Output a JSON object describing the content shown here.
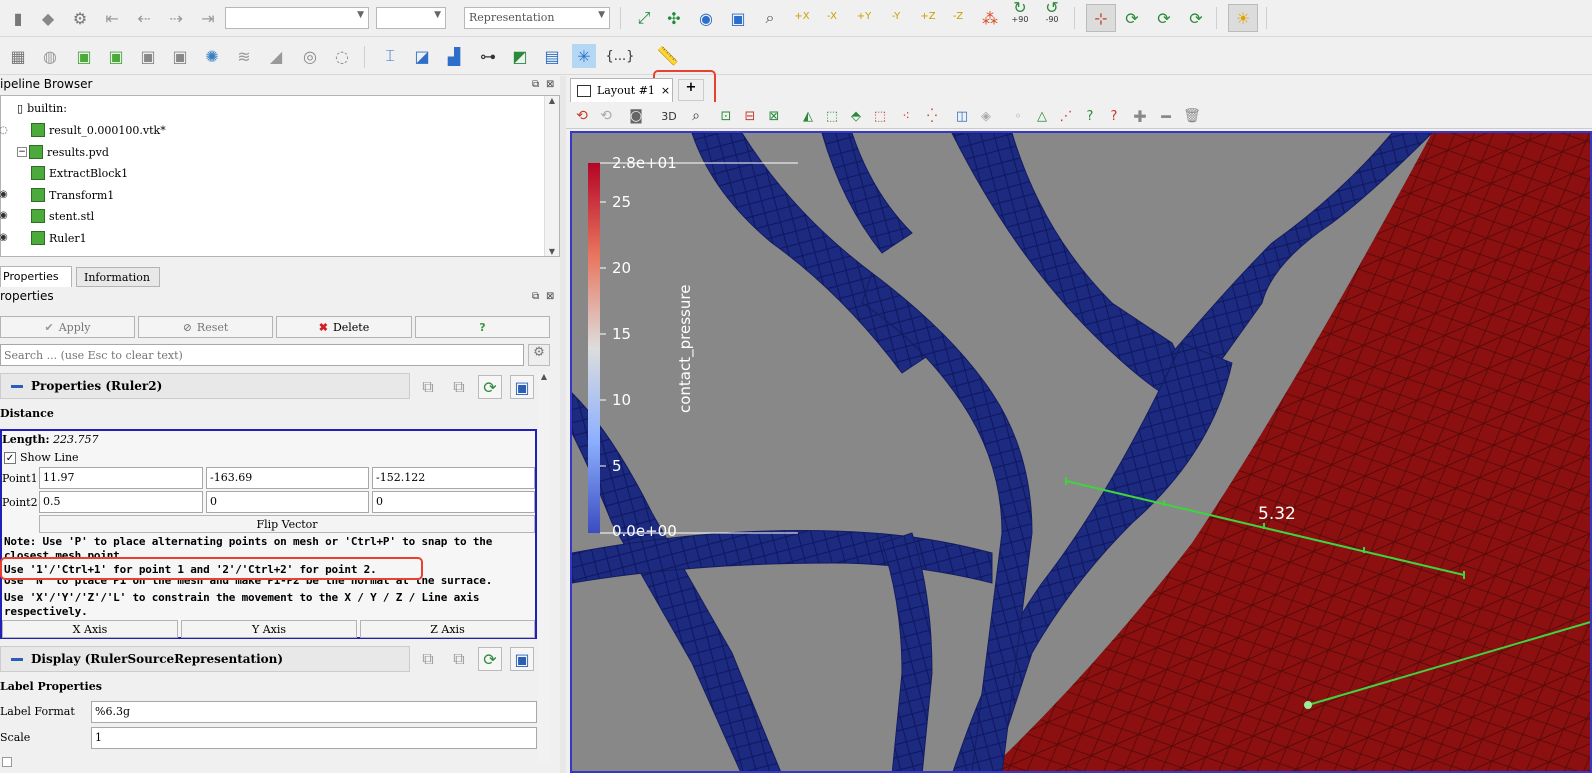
{
  "toolbar1": {
    "representation": "Representation",
    "rotate_plus": "+90",
    "rotate_minus": "-90",
    "axis_buttons": [
      "+X",
      "-X",
      "+Y",
      "-Y",
      "+Z",
      "-Z"
    ]
  },
  "toolbar2": {
    "braces_label": "{...}"
  },
  "pipeline": {
    "title": "ipeline Browser",
    "items": [
      {
        "label": "builtin:"
      },
      {
        "label": "result_0.000100.vtk*"
      },
      {
        "label": "results.pvd"
      },
      {
        "label": "ExtractBlock1"
      },
      {
        "label": "Transform1"
      },
      {
        "label": "stent.stl"
      },
      {
        "label": "Ruler1"
      }
    ]
  },
  "tabs": {
    "properties": "Properties",
    "information": "Information"
  },
  "properties": {
    "header": "roperties",
    "apply": "Apply",
    "reset": "Reset",
    "delete": "Delete",
    "help": "?",
    "search_placeholder": "Search ... (use Esc to clear text)",
    "section_title": "Properties (Ruler2)",
    "distance_label": "Distance",
    "length_label": "Length:",
    "length_value": "223.757",
    "show_line": "Show Line",
    "point1_label": "Point1",
    "point1": [
      "11.97",
      "-163.69",
      "-152.122"
    ],
    "point2_label": "Point2",
    "point2": [
      "0.5",
      "0",
      "0"
    ],
    "flip_vector": "Flip Vector",
    "note1": "Note: Use 'P' to place alternating points on mesh or 'Ctrl+P' to snap to the",
    "note1b": "closest mesh point.",
    "note2": "Use '1'/'Ctrl+1' for point 1 and '2'/'Ctrl+2' for point 2.",
    "note3": "Use 'N' to place P1 on the mesh and make P1-P2 be the normal at the surface.",
    "note4": "Use 'X'/'Y'/'Z'/'L' to constrain the movement to the X / Y / Z / Line axis",
    "note5": "respectively.",
    "x_axis": "X Axis",
    "y_axis": "Y Axis",
    "z_axis": "Z Axis",
    "display_title": "Display (RulerSourceRepresentation)",
    "label_properties": "Label Properties",
    "label_format_label": "Label Format",
    "label_format_value": "%6.3g",
    "scale_label": "Scale",
    "scale_value": "1"
  },
  "layout": {
    "tab": "Layout #1",
    "close": "×",
    "add": "+",
    "mode_3d": "3D"
  },
  "viewport": {
    "colorbar_title": "contact_pressure",
    "colorbar_ticks": [
      "2.8e+01",
      "25",
      "20",
      "15",
      "10",
      "5",
      "0.0e+00"
    ],
    "ruler_label": "5.32"
  },
  "colors": {
    "stent": "#1c2a80",
    "mesh_red": "#8c1010",
    "ruler_green": "#3fd43f",
    "highlight_red": "#e8412f"
  }
}
